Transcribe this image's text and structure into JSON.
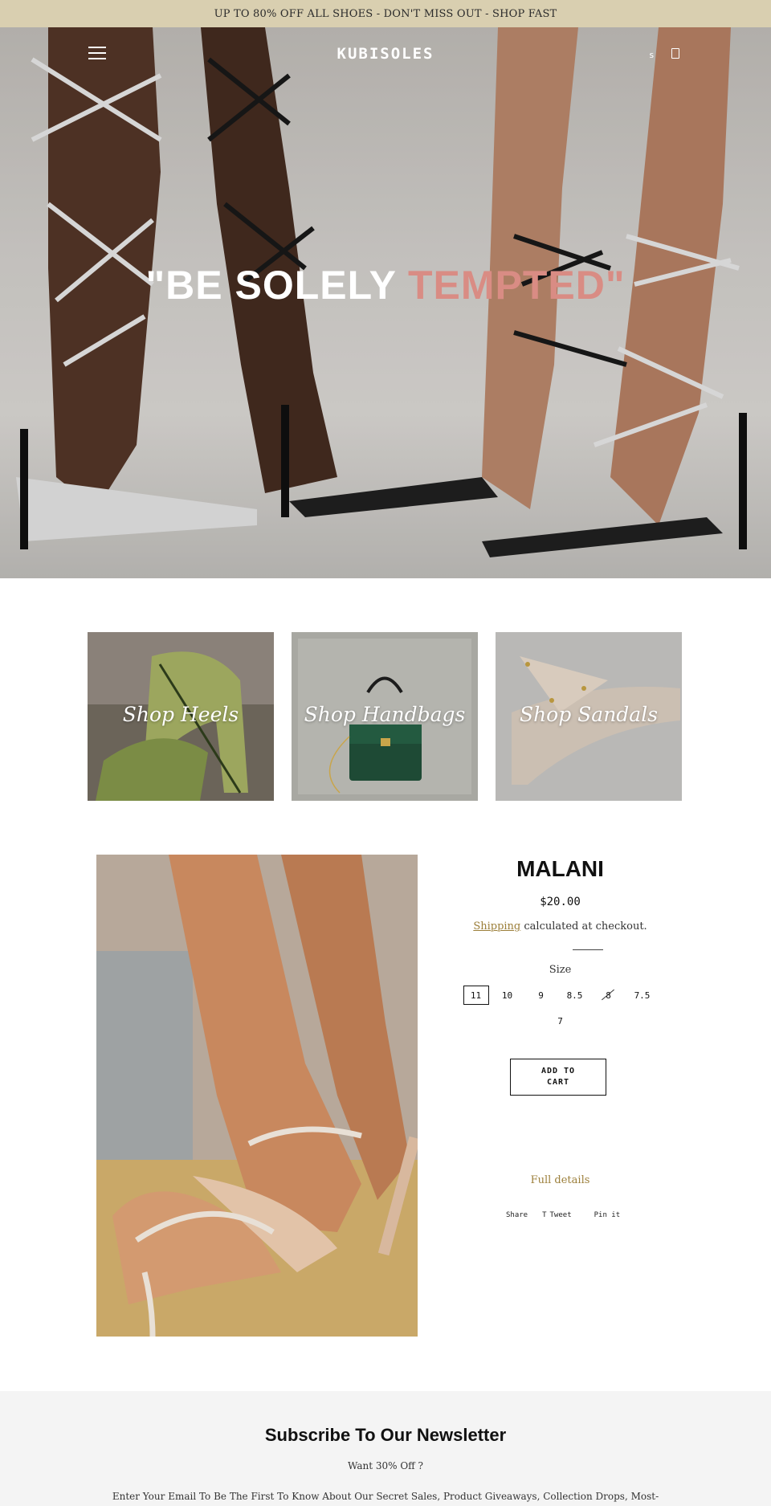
{
  "announcement": "UP TO 80% OFF ALL SHOES - DON'T MISS OUT - SHOP FAST",
  "header": {
    "logo": "KUBISOLES",
    "search_label": "s"
  },
  "hero": {
    "title_main": "\"BE SOLELY ",
    "title_accent": "TEMPTED\""
  },
  "collections": [
    {
      "label": "Shop Heels"
    },
    {
      "label": "Shop Handbags"
    },
    {
      "label": "Shop Sandals"
    }
  ],
  "product": {
    "title": "MALANI",
    "price": "$20.00",
    "shipping_link": "Shipping",
    "shipping_text": " calculated at checkout.",
    "size_label": "Size",
    "sizes": [
      "11",
      "10",
      "9",
      "8.5",
      "8",
      "7.5",
      "7"
    ],
    "selected_size": "11",
    "unavailable_size": "8",
    "add_to_cart": "ADD TO CART",
    "full_details": "Full details",
    "share": {
      "share": "Share",
      "tweet": "Tweet",
      "pin": "Pin it"
    }
  },
  "newsletter": {
    "title": "Subscribe To Our Newsletter",
    "subtitle": "Want 30% Off ?",
    "body": "Enter Your Email To Be The First To Know About Our Secret Sales, Product Giveaways, Collection Drops, Most-"
  },
  "colors": {
    "announcement_bg": "#d9cfb0",
    "accent_gold": "#9c7f3a",
    "hero_accent": "#d98c84",
    "newsletter_bg": "#f4f4f4"
  },
  "icons": [
    "hamburger-menu-icon",
    "search-icon",
    "cart-icon",
    "twitter-icon"
  ]
}
